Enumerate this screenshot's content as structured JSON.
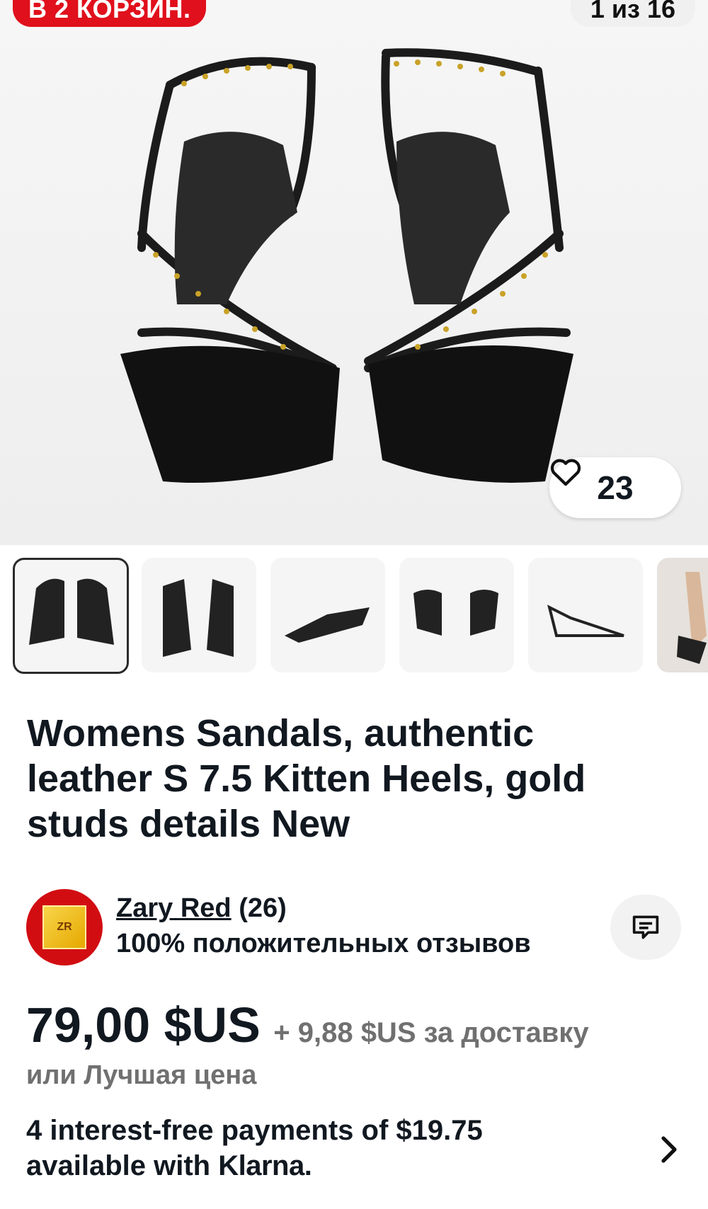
{
  "header": {
    "cart_badge": "В 2 КОРЗИН.",
    "image_counter": "1 из 16"
  },
  "gallery": {
    "watch_count": "23",
    "thumbnails": [
      {
        "name": "thumb-front"
      },
      {
        "name": "thumb-top"
      },
      {
        "name": "thumb-side"
      },
      {
        "name": "thumb-back"
      },
      {
        "name": "thumb-profile"
      },
      {
        "name": "thumb-worn"
      }
    ]
  },
  "listing": {
    "title": "Womens Sandals, authentic leather S 7.5 Kitten Heels, gold studs details New"
  },
  "seller": {
    "name": "Zary Red",
    "count": "(26)",
    "feedback": "100% положительных отзывов"
  },
  "pricing": {
    "price": "79,00 $US",
    "shipping": "+ 9,88 $US за доставку",
    "best_offer": "или Лучшая цена"
  },
  "klarna": {
    "line1": "4 interest-free payments of $19.75",
    "line2_prefix": "available with ",
    "brand": "Klarna."
  },
  "colors": {
    "badge_red": "#e0101c",
    "text": "#111820",
    "muted": "#707070"
  }
}
